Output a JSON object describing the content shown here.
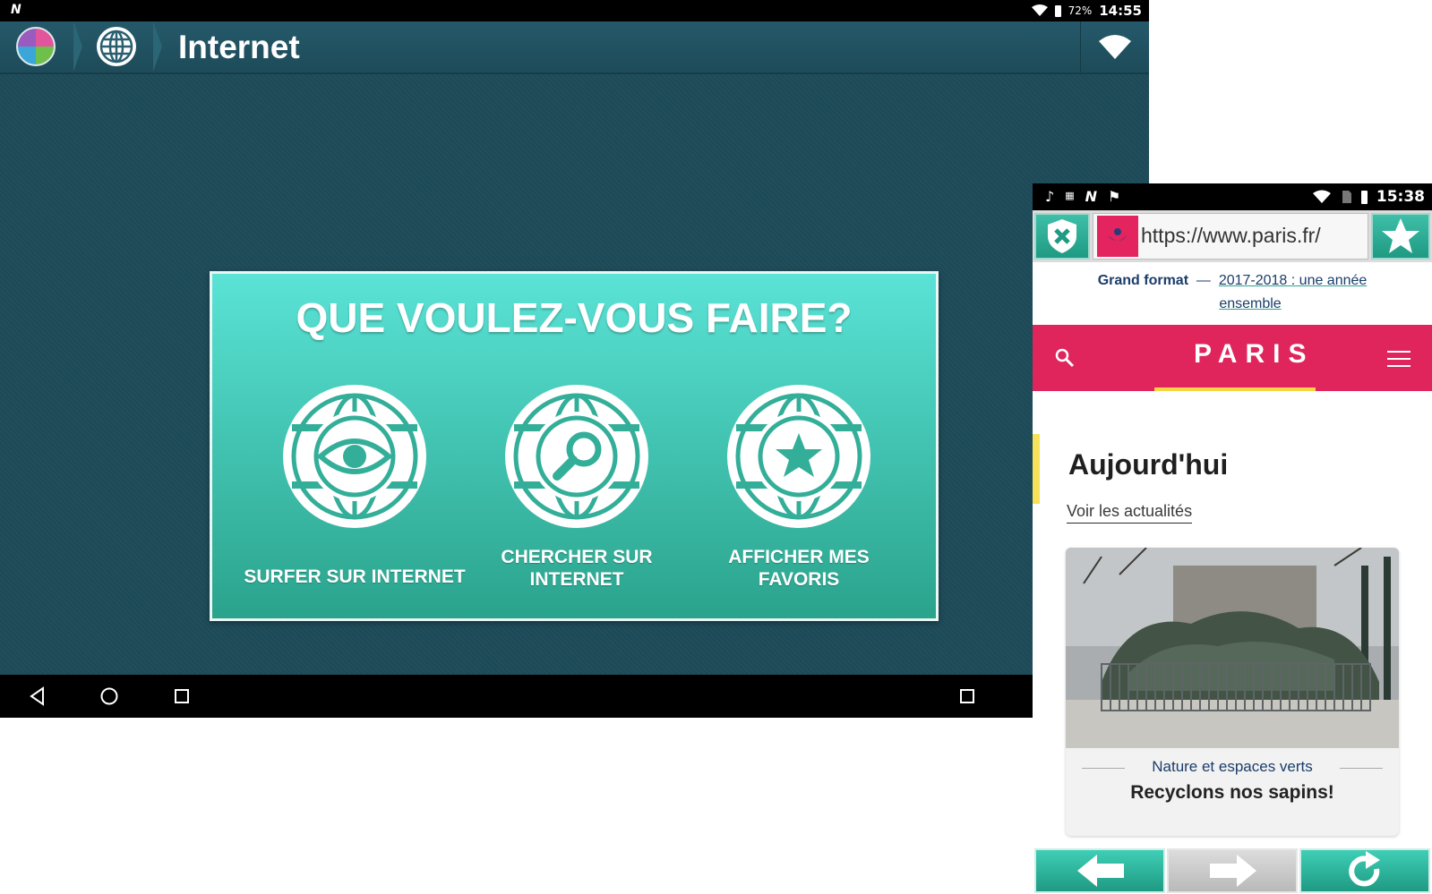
{
  "tablet": {
    "statusbar": {
      "battery_pct": "72%",
      "time": "14:55"
    },
    "appbar": {
      "title": "Internet"
    },
    "panel": {
      "heading": "QUE VOULEZ-VOUS FAIRE?",
      "choices": [
        {
          "label": "SURFER SUR INTERNET",
          "icon": "eye-globe-icon"
        },
        {
          "label": "CHERCHER SUR INTERNET",
          "icon": "search-globe-icon"
        },
        {
          "label": "AFFICHER MES FAVORIS",
          "icon": "star-globe-icon"
        }
      ]
    },
    "colors": {
      "background": "#1f4c5a",
      "panel_top": "#5ae3d6",
      "panel_bottom": "#2aa38c"
    }
  },
  "phone": {
    "statusbar": {
      "time": "15:38"
    },
    "url": "https://www.paris.fr/",
    "promo": {
      "label": "Grand format",
      "dash": "—",
      "link_line1": "2017-2018 : une année",
      "link_line2": "ensemble"
    },
    "brand": "PARIS",
    "section_title": "Aujourd'hui",
    "news_link": "Voir les actualités",
    "card": {
      "category": "Nature et espaces verts",
      "headline": "Recyclons nos sapins!"
    },
    "colors": {
      "brand": "#e0245c",
      "accent": "#f5d547",
      "toolbar": "#1f9a83"
    }
  }
}
